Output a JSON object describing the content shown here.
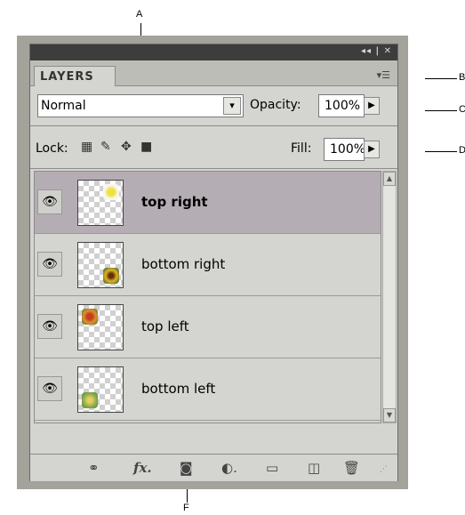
{
  "callouts": {
    "a": "A",
    "b": "B",
    "c": "C",
    "d": "D",
    "f": "F"
  },
  "panel": {
    "window_controls": "◂◂ | ✕",
    "tab_label": "LAYERS",
    "menu_icon": "panel-menu-icon"
  },
  "blend_mode": {
    "value": "Normal",
    "drop_glyph": "▾"
  },
  "opacity": {
    "label": "Opacity:",
    "value": "100%"
  },
  "lock": {
    "label": "Lock:",
    "icons": [
      "lock-transparent-pixels-icon",
      "lock-image-pixels-icon",
      "lock-position-icon",
      "lock-all-icon"
    ]
  },
  "fill": {
    "label": "Fill:",
    "value": "100%"
  },
  "layers": [
    {
      "name": "top right",
      "selected": true,
      "flower_pos": "top-right",
      "flower_color": "#e8e0a0"
    },
    {
      "name": "bottom right",
      "selected": false,
      "flower_pos": "bottom-right",
      "flower_color": "#d8a020"
    },
    {
      "name": "top left",
      "selected": false,
      "flower_pos": "top-left",
      "flower_color": "#d07030"
    },
    {
      "name": "bottom left",
      "selected": false,
      "flower_pos": "bottom-left",
      "flower_color": "#a0c060"
    }
  ],
  "footer_icons": [
    "link-layers-icon",
    "fx-layer-style-icon",
    "add-mask-icon",
    "adjustment-layer-icon",
    "new-group-icon",
    "new-layer-icon",
    "delete-layer-icon"
  ],
  "colors": {
    "selected_row": "#b5adb4",
    "titlebar": "#3d3d3d",
    "panel_bg": "#d4d4d0"
  }
}
